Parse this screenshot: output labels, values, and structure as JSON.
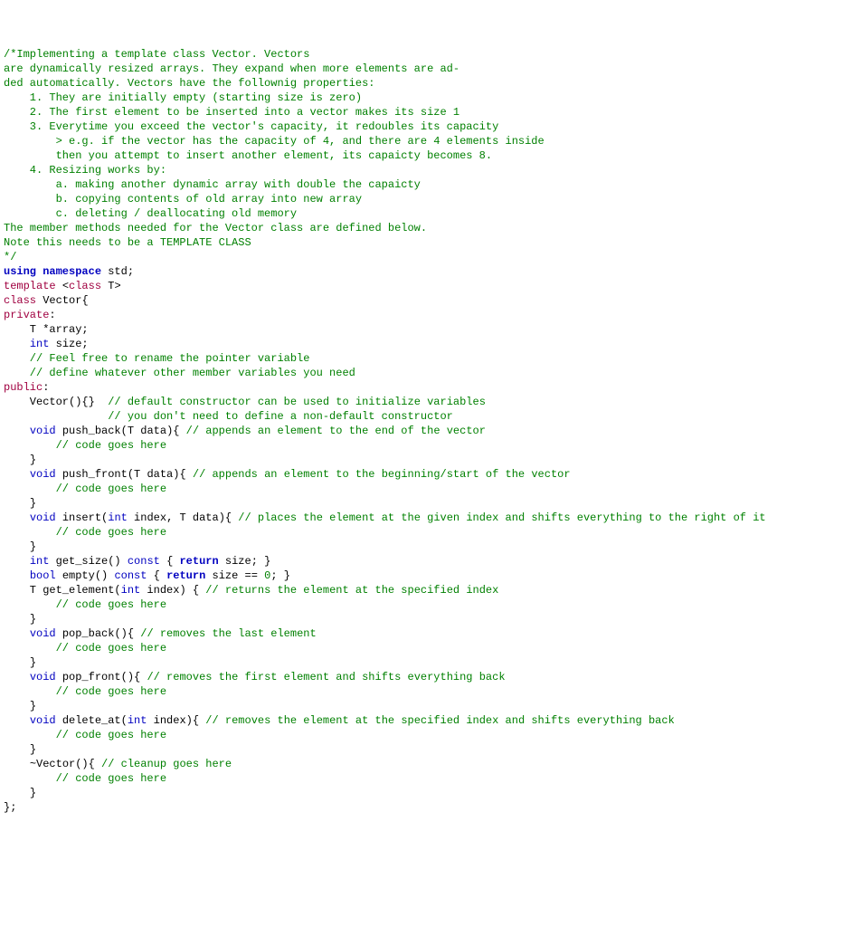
{
  "lines": [
    [
      [
        "comment",
        "/*Implementing a template class Vector. Vectors"
      ]
    ],
    [
      [
        "comment",
        "are dynamically resized arrays. They expand when more elements are ad-"
      ]
    ],
    [
      [
        "comment",
        "ded automatically. Vectors have the follownig properties:"
      ]
    ],
    [
      [
        "comment",
        "    1. They are initially empty (starting size is zero)"
      ]
    ],
    [
      [
        "comment",
        "    2. The first element to be inserted into a vector makes its size 1"
      ]
    ],
    [
      [
        "comment",
        "    3. Everytime you exceed the vector's capacity, it redoubles its capacity"
      ]
    ],
    [
      [
        "comment",
        "        > e.g. if the vector has the capacity of 4, and there are 4 elements inside"
      ]
    ],
    [
      [
        "comment",
        "        then you attempt to insert another element, its capaicty becomes 8."
      ]
    ],
    [
      [
        "comment",
        "    4. Resizing works by:"
      ]
    ],
    [
      [
        "comment",
        "        a. making another dynamic array with double the capaicty"
      ]
    ],
    [
      [
        "comment",
        "        b. copying contents of old array into new array"
      ]
    ],
    [
      [
        "comment",
        "        c. deleting / deallocating old memory"
      ]
    ],
    [
      [
        "comment",
        ""
      ]
    ],
    [
      [
        "comment",
        "The member methods needed for the Vector class are defined below."
      ]
    ],
    [
      [
        "comment",
        "Note this needs to be a TEMPLATE CLASS"
      ]
    ],
    [
      [
        "comment",
        "*/"
      ]
    ],
    [
      [
        "plain",
        ""
      ]
    ],
    [
      [
        "keyword",
        "using namespace"
      ],
      [
        "plain",
        " std;"
      ]
    ],
    [
      [
        "plain",
        ""
      ]
    ],
    [
      [
        "prep",
        "template "
      ],
      [
        "op",
        "<"
      ],
      [
        "classkw",
        "class"
      ],
      [
        "plain",
        " T"
      ],
      [
        "op",
        ">"
      ]
    ],
    [
      [
        "classkw",
        "class"
      ],
      [
        "plain",
        " Vector"
      ],
      [
        "op",
        "{"
      ]
    ],
    [
      [
        "classkw",
        "private"
      ],
      [
        "op",
        ":"
      ]
    ],
    [
      [
        "plain",
        "    T "
      ],
      [
        "op",
        "*"
      ],
      [
        "plain",
        "array;"
      ]
    ],
    [
      [
        "plain",
        "    "
      ],
      [
        "type",
        "int"
      ],
      [
        "plain",
        " size;"
      ]
    ],
    [
      [
        "comment",
        "    // Feel free to rename the pointer variable"
      ]
    ],
    [
      [
        "comment",
        "    // define whatever other member variables you need"
      ]
    ],
    [
      [
        "classkw",
        "public"
      ],
      [
        "op",
        ":"
      ]
    ],
    [
      [
        "plain",
        "    Vector"
      ],
      [
        "op",
        "(){}"
      ],
      [
        "plain",
        "  "
      ],
      [
        "comment",
        "// default constructor can be used to initialize variables"
      ]
    ],
    [
      [
        "plain",
        "                "
      ],
      [
        "comment",
        "// you don't need to define a non-default constructor"
      ]
    ],
    [
      [
        "plain",
        ""
      ]
    ],
    [
      [
        "plain",
        "    "
      ],
      [
        "type",
        "void"
      ],
      [
        "plain",
        " push_back"
      ],
      [
        "op",
        "("
      ],
      [
        "plain",
        "T data"
      ],
      [
        "op",
        "){"
      ],
      [
        "plain",
        " "
      ],
      [
        "comment",
        "// appends an element to the end of the vector"
      ]
    ],
    [
      [
        "plain",
        "        "
      ],
      [
        "comment",
        "// code goes here"
      ]
    ],
    [
      [
        "plain",
        "    "
      ],
      [
        "op",
        "}"
      ]
    ],
    [
      [
        "plain",
        ""
      ]
    ],
    [
      [
        "plain",
        "    "
      ],
      [
        "type",
        "void"
      ],
      [
        "plain",
        " push_front"
      ],
      [
        "op",
        "("
      ],
      [
        "plain",
        "T data"
      ],
      [
        "op",
        "){"
      ],
      [
        "plain",
        " "
      ],
      [
        "comment",
        "// appends an element to the beginning/start of the vector"
      ]
    ],
    [
      [
        "plain",
        "        "
      ],
      [
        "comment",
        "// code goes here"
      ]
    ],
    [
      [
        "plain",
        "    "
      ],
      [
        "op",
        "}"
      ]
    ],
    [
      [
        "plain",
        ""
      ]
    ],
    [
      [
        "plain",
        "    "
      ],
      [
        "type",
        "void"
      ],
      [
        "plain",
        " insert"
      ],
      [
        "op",
        "("
      ],
      [
        "type",
        "int"
      ],
      [
        "plain",
        " index, T data"
      ],
      [
        "op",
        "){"
      ],
      [
        "plain",
        " "
      ],
      [
        "comment",
        "// places the element at the given index and shifts everything to the right of it"
      ]
    ],
    [
      [
        "plain",
        "        "
      ],
      [
        "comment",
        "// code goes here"
      ]
    ],
    [
      [
        "plain",
        "    "
      ],
      [
        "op",
        "}"
      ]
    ],
    [
      [
        "plain",
        ""
      ]
    ],
    [
      [
        "plain",
        "    "
      ],
      [
        "type",
        "int"
      ],
      [
        "plain",
        " get_size"
      ],
      [
        "op",
        "()"
      ],
      [
        "plain",
        " "
      ],
      [
        "keyword2",
        "const"
      ],
      [
        "plain",
        " "
      ],
      [
        "op",
        "{"
      ],
      [
        "plain",
        " "
      ],
      [
        "keyword",
        "return"
      ],
      [
        "plain",
        " size; "
      ],
      [
        "op",
        "}"
      ]
    ],
    [
      [
        "plain",
        "    "
      ],
      [
        "type",
        "bool"
      ],
      [
        "plain",
        " empty"
      ],
      [
        "op",
        "()"
      ],
      [
        "plain",
        " "
      ],
      [
        "keyword2",
        "const"
      ],
      [
        "plain",
        " "
      ],
      [
        "op",
        "{"
      ],
      [
        "plain",
        " "
      ],
      [
        "keyword",
        "return"
      ],
      [
        "plain",
        " size "
      ],
      [
        "op",
        "=="
      ],
      [
        "plain",
        " "
      ],
      [
        "num",
        "0"
      ],
      [
        "plain",
        "; "
      ],
      [
        "op",
        "}"
      ]
    ],
    [
      [
        "plain",
        ""
      ]
    ],
    [
      [
        "plain",
        "    T get_element"
      ],
      [
        "op",
        "("
      ],
      [
        "type",
        "int"
      ],
      [
        "plain",
        " index"
      ],
      [
        "op",
        ")"
      ],
      [
        "plain",
        " "
      ],
      [
        "op",
        "{"
      ],
      [
        "plain",
        " "
      ],
      [
        "comment",
        "// returns the element at the specified index"
      ]
    ],
    [
      [
        "plain",
        "        "
      ],
      [
        "comment",
        "// code goes here"
      ]
    ],
    [
      [
        "plain",
        "    "
      ],
      [
        "op",
        "}"
      ]
    ],
    [
      [
        "plain",
        ""
      ]
    ],
    [
      [
        "plain",
        "    "
      ],
      [
        "type",
        "void"
      ],
      [
        "plain",
        " pop_back"
      ],
      [
        "op",
        "(){"
      ],
      [
        "plain",
        " "
      ],
      [
        "comment",
        "// removes the last element"
      ]
    ],
    [
      [
        "plain",
        "        "
      ],
      [
        "comment",
        "// code goes here"
      ]
    ],
    [
      [
        "plain",
        "    "
      ],
      [
        "op",
        "}"
      ]
    ],
    [
      [
        "plain",
        ""
      ]
    ],
    [
      [
        "plain",
        "    "
      ],
      [
        "type",
        "void"
      ],
      [
        "plain",
        " pop_front"
      ],
      [
        "op",
        "(){"
      ],
      [
        "plain",
        " "
      ],
      [
        "comment",
        "// removes the first element and shifts everything back"
      ]
    ],
    [
      [
        "plain",
        "        "
      ],
      [
        "comment",
        "// code goes here"
      ]
    ],
    [
      [
        "plain",
        "    "
      ],
      [
        "op",
        "}"
      ]
    ],
    [
      [
        "plain",
        ""
      ]
    ],
    [
      [
        "plain",
        "    "
      ],
      [
        "type",
        "void"
      ],
      [
        "plain",
        " delete_at"
      ],
      [
        "op",
        "("
      ],
      [
        "type",
        "int"
      ],
      [
        "plain",
        " index"
      ],
      [
        "op",
        "){"
      ],
      [
        "plain",
        " "
      ],
      [
        "comment",
        "// removes the element at the specified index and shifts everything back"
      ]
    ],
    [
      [
        "plain",
        "        "
      ],
      [
        "comment",
        "// code goes here"
      ]
    ],
    [
      [
        "plain",
        "    "
      ],
      [
        "op",
        "}"
      ]
    ],
    [
      [
        "plain",
        ""
      ]
    ],
    [
      [
        "plain",
        "    "
      ],
      [
        "op",
        "~"
      ],
      [
        "plain",
        "Vector"
      ],
      [
        "op",
        "(){"
      ],
      [
        "plain",
        " "
      ],
      [
        "comment",
        "// cleanup goes here"
      ]
    ],
    [
      [
        "plain",
        "        "
      ],
      [
        "comment",
        "// code goes here"
      ]
    ],
    [
      [
        "plain",
        "    "
      ],
      [
        "op",
        "}"
      ]
    ],
    [
      [
        "op",
        "};"
      ]
    ]
  ]
}
